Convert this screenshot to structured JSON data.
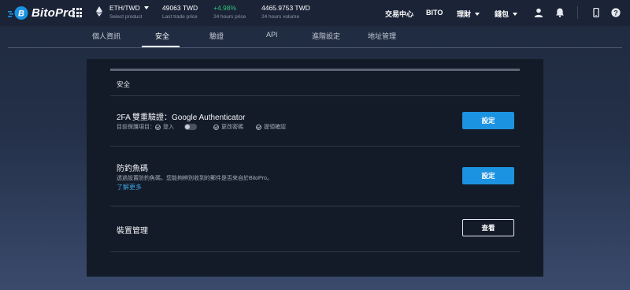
{
  "header": {
    "brand": "BitoPro",
    "pair": "ETH/TWD",
    "pair_sub": "Select product",
    "last_price": "49063 TWD",
    "last_price_label": "Last trade price",
    "change": "+4.98%",
    "change_label": "24 hours price",
    "volume": "4465.9753 TWD",
    "volume_label": "24 hours volume",
    "nav": {
      "exchange": "交易中心",
      "bito": "BITO",
      "finance": "理財",
      "wallet": "錢包"
    }
  },
  "tabs": [
    "個人資訊",
    "安全",
    "驗證",
    "API",
    "進階設定",
    "地址管理"
  ],
  "active_tab": "安全",
  "panel": {
    "section_title": "安全",
    "twofa": {
      "title": "2FA 雙重驗證：Google Authenticator",
      "protect_label": "目前保護項目：",
      "opt_login": "登入",
      "opt_password": "更改密碼",
      "opt_withdraw": "提領確認",
      "button": "設定"
    },
    "antiphishing": {
      "title": "防釣魚碼",
      "desc": "透過設置防釣魚碼，您能夠辨別收到的郵件是否來自於BitoPro。",
      "learn_more": "了解更多",
      "button": "設定"
    },
    "devices": {
      "title": "裝置管理",
      "button": "查看"
    }
  },
  "colors": {
    "accent": "#1c93e0",
    "positive": "#35c07a",
    "link": "#3aa3e6",
    "panel_bg": "#141b28",
    "topbar_bg": "#1b2437"
  }
}
